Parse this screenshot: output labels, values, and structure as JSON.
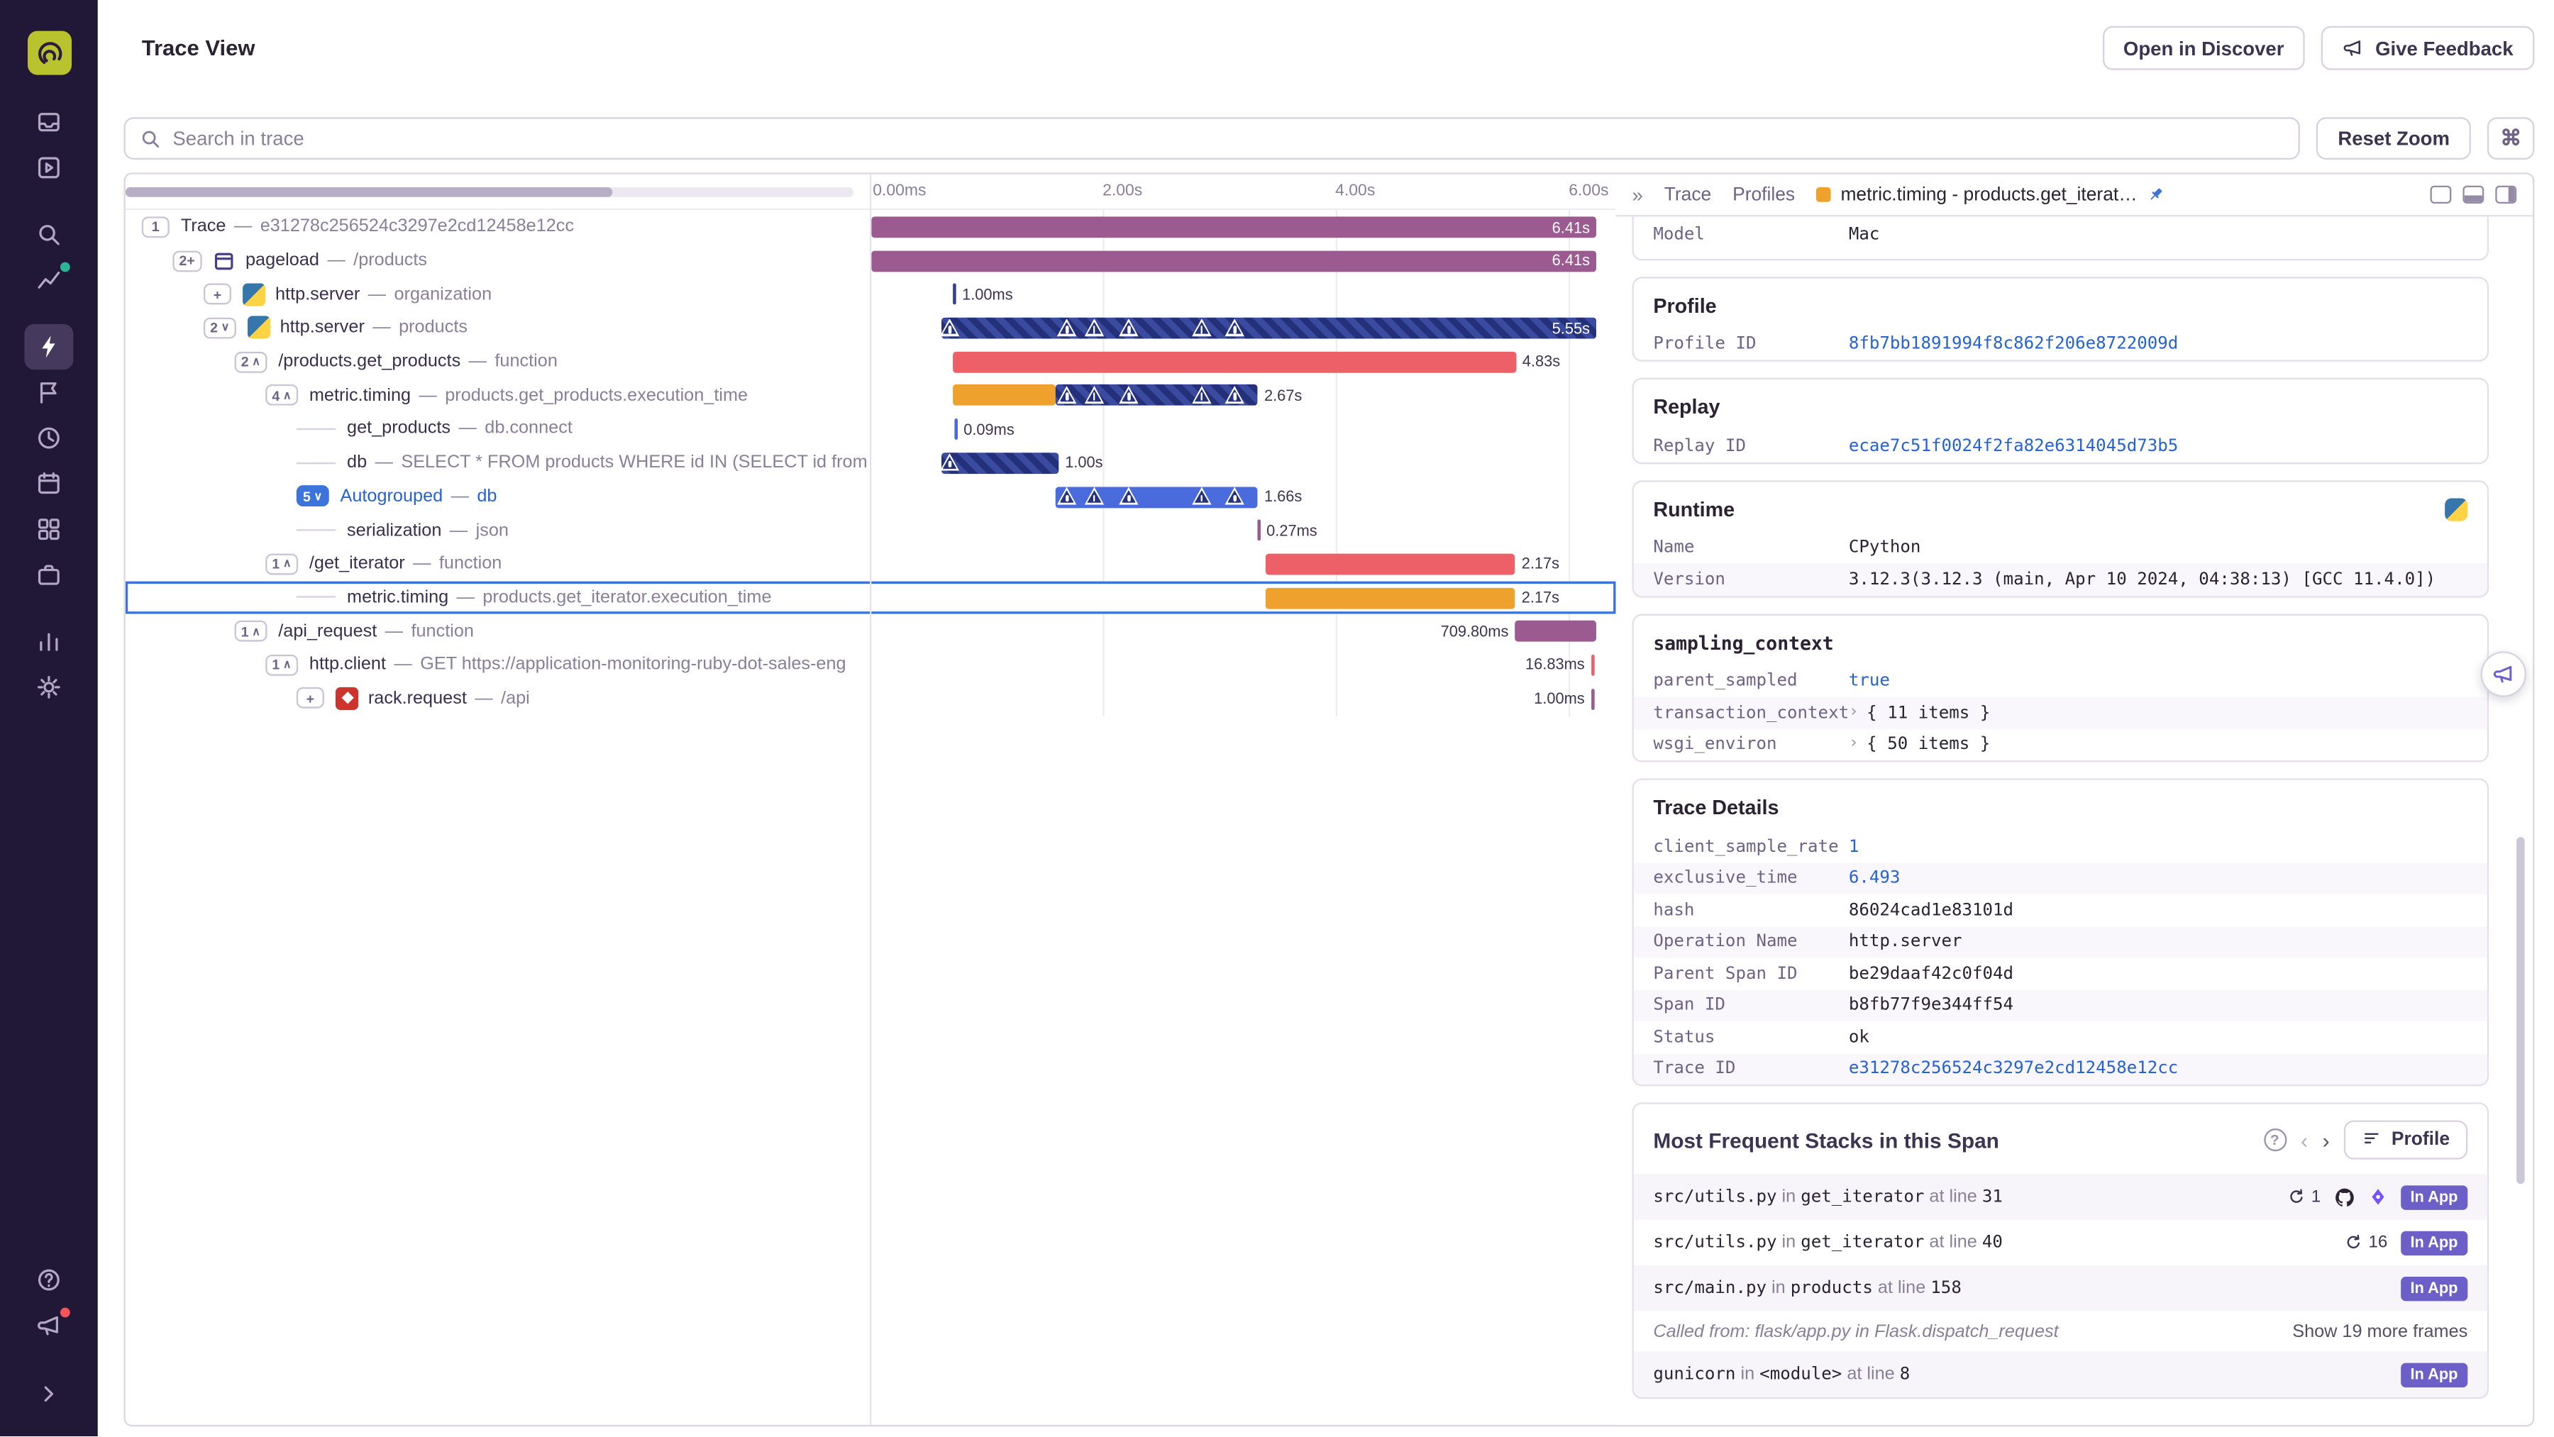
{
  "header": {
    "title": "Trace View",
    "open_in_discover": "Open in Discover",
    "give_feedback": "Give Feedback"
  },
  "toolbar": {
    "search_placeholder": "Search in trace",
    "reset_zoom": "Reset Zoom",
    "shortcut": "⌘"
  },
  "sidebar": {
    "items": [
      "issues",
      "projects",
      "explore-search",
      "stats",
      "performance",
      "releases",
      "history",
      "crons",
      "dashboards",
      "organization",
      "insights",
      "settings"
    ],
    "active": "performance",
    "bottom": [
      "help",
      "whats-new",
      "collapse"
    ]
  },
  "timeline": {
    "ticks": [
      {
        "label": "0.00ms",
        "pct": 0.4
      },
      {
        "label": "2.00s",
        "pct": 31.2
      },
      {
        "label": "4.00s",
        "pct": 62.4
      },
      {
        "label": "6.00s",
        "pct": 93.7
      }
    ]
  },
  "trace": {
    "separator": "—",
    "rows": [
      {
        "depth": 0,
        "badge": "1",
        "op": "Trace",
        "desc": "e31278c256524c3297e2cd12458e12cc",
        "segs": [
          {
            "l": 0.2,
            "w": 97.2,
            "c": "purple"
          }
        ],
        "label": "6.41s",
        "lp": "inside"
      },
      {
        "depth": 1,
        "badge": "2+",
        "icon": "pageload",
        "op": "pageload",
        "desc": "/products",
        "segs": [
          {
            "l": 0.2,
            "w": 97.2,
            "c": "purple"
          }
        ],
        "label": "6.41s",
        "lp": "inside"
      },
      {
        "depth": 2,
        "badge": "+",
        "icon": "python",
        "op": "http.server",
        "desc": "organization",
        "segs": [
          {
            "l": 11.1,
            "w": 0.4,
            "c": "navy"
          }
        ],
        "label": "1.00ms",
        "lp": "after"
      },
      {
        "depth": 2,
        "badge": "2",
        "chev": "down",
        "icon": "python",
        "op": "http.server",
        "desc": "products",
        "segs": [
          {
            "l": 9.6,
            "w": 87.8,
            "c": "striped"
          }
        ],
        "tris": [
          10.7,
          26.4,
          30.1,
          34.7,
          44.5,
          48.9
        ],
        "label": "5.55s",
        "lp": "inside"
      },
      {
        "depth": 3,
        "badge": "2",
        "chev": "up",
        "op": "/products.get_products",
        "desc": "function",
        "segs": [
          {
            "l": 11.1,
            "w": 75.5,
            "c": "red"
          }
        ],
        "label": "4.83s",
        "lp": "after"
      },
      {
        "depth": 4,
        "badge": "4",
        "chev": "up",
        "op": "metric.timing",
        "desc": "products.get_products.execution_time",
        "segs": [
          {
            "l": 11.1,
            "w": 13.8,
            "c": "orange"
          },
          {
            "l": 24.9,
            "w": 27.1,
            "c": "striped"
          }
        ],
        "tris": [
          26.4,
          30.1,
          34.7,
          44.5,
          48.9
        ],
        "label": "2.67s",
        "lp": "after"
      },
      {
        "depth": 5,
        "op": "get_products",
        "desc": "db.connect",
        "segs": [
          {
            "l": 11.4,
            "w": 0.3,
            "c": "blue"
          }
        ],
        "label": "0.09ms",
        "lp": "after"
      },
      {
        "depth": 5,
        "op": "db",
        "desc": "SELECT * FROM products WHERE id IN (SELECT id from produc",
        "segs": [
          {
            "l": 9.6,
            "w": 15.7,
            "c": "striped"
          }
        ],
        "tris": [
          10.7
        ],
        "label": "1.00s",
        "lp": "after"
      },
      {
        "depth": 5,
        "badge": "5",
        "chev": "down",
        "badge_style": "blue",
        "blue": true,
        "op": "Autogrouped",
        "desc": "db",
        "segs": [
          {
            "l": 24.9,
            "w": 27.1,
            "c": "blue"
          }
        ],
        "tris": [
          26.4,
          30.1,
          34.7,
          44.5,
          48.9
        ],
        "label": "1.66s",
        "lp": "after"
      },
      {
        "depth": 5,
        "op": "serialization",
        "desc": "json",
        "segs": [
          {
            "l": 52.0,
            "w": 0.3,
            "c": "purple"
          }
        ],
        "label": "0.27ms",
        "lp": "after"
      },
      {
        "depth": 4,
        "badge": "1",
        "chev": "up",
        "op": "/get_iterator",
        "desc": "function",
        "segs": [
          {
            "l": 53.1,
            "w": 33.4,
            "c": "red"
          }
        ],
        "label": "2.17s",
        "lp": "after"
      },
      {
        "depth": 5,
        "selected": true,
        "op": "metric.timing",
        "desc": "products.get_iterator.execution_time",
        "segs": [
          {
            "l": 53.1,
            "w": 33.4,
            "c": "orange"
          }
        ],
        "label": "2.17s",
        "lp": "after"
      },
      {
        "depth": 3,
        "badge": "1",
        "chev": "up",
        "op": "/api_request",
        "desc": "function",
        "segs": [
          {
            "l": 86.5,
            "w": 10.9,
            "c": "purple"
          }
        ],
        "label": "709.80ms",
        "lp": "before"
      },
      {
        "depth": 4,
        "badge": "1",
        "chev": "up",
        "op": "http.client",
        "desc": "GET https://application-monitoring-ruby-dot-sales-eng",
        "segs": [
          {
            "l": 96.7,
            "w": 0.45,
            "c": "red"
          }
        ],
        "label": "16.83ms",
        "lp": "before"
      },
      {
        "depth": 5,
        "badge": "+",
        "icon": "ruby",
        "op": "rack.request",
        "desc": "/api",
        "segs": [
          {
            "l": 96.7,
            "w": 0.45,
            "c": "purple"
          }
        ],
        "label": "1.00ms",
        "lp": "before"
      }
    ]
  },
  "tabs": {
    "collapse": "»",
    "trace": "Trace",
    "profiles": "Profiles",
    "active_label": "metric.timing - products.get_iterat…"
  },
  "details": {
    "cards": [
      {
        "cut": true,
        "rows": [
          {
            "k": "Model",
            "v": "Mac"
          }
        ]
      },
      {
        "title": "Profile",
        "rows": [
          {
            "k": "Profile ID",
            "v": "8fb7bb1891994f8c862f206e8722009d",
            "t": "link"
          }
        ]
      },
      {
        "title": "Replay",
        "rows": [
          {
            "k": "Replay ID",
            "v": "ecae7c51f0024f2fa82e6314045d73b5",
            "t": "link"
          }
        ]
      },
      {
        "title": "Runtime",
        "icon": "python",
        "rows": [
          {
            "k": "Name",
            "v": "CPython"
          },
          {
            "k": "Version",
            "v": "3.12.3(3.12.3 (main, Apr 10 2024, 04:38:13) [GCC 11.4.0])"
          }
        ]
      },
      {
        "title": "sampling_context",
        "mono": true,
        "rows": [
          {
            "k": "parent_sampled",
            "v": "true",
            "t": "num"
          },
          {
            "k": "transaction_context",
            "v": "{ 11 items }",
            "exp": true
          },
          {
            "k": "wsgi_environ",
            "v": "{ 50 items }",
            "exp": true
          }
        ]
      },
      {
        "title": "Trace Details",
        "rows": [
          {
            "k": "client_sample_rate",
            "v": "1",
            "t": "num"
          },
          {
            "k": "exclusive_time",
            "v": "6.493",
            "t": "num"
          },
          {
            "k": "hash",
            "v": "86024cad1e83101d"
          },
          {
            "k": "Operation Name",
            "v": "http.server"
          },
          {
            "k": "Parent Span ID",
            "v": "be29daaf42c0f04d"
          },
          {
            "k": "Span ID",
            "v": "b8fb77f9e344ff54"
          },
          {
            "k": "Status",
            "v": "ok"
          },
          {
            "k": "Trace ID",
            "v": "e31278c256524c3297e2cd12458e12cc",
            "t": "link"
          }
        ]
      }
    ]
  },
  "stacks": {
    "title": "Most Frequent Stacks in this Span",
    "profile_label": "Profile",
    "in_word": "in",
    "at_line_word": "at line",
    "frames": [
      {
        "file": "src/utils.py",
        "fn": "get_iterator",
        "line": "31",
        "count": "1",
        "extra_icons": true,
        "badge": "In App"
      },
      {
        "file": "src/utils.py",
        "fn": "get_iterator",
        "line": "40",
        "count": "16",
        "badge": "In App"
      },
      {
        "file": "src/main.py",
        "fn": "products",
        "line": "158",
        "badge": "In App"
      },
      {
        "called": "Called from: flask/app.py in Flask.dispatch_request",
        "more": "Show 19 more frames"
      },
      {
        "file": "gunicorn",
        "fn": "<module>",
        "line": "8",
        "badge": "In App"
      }
    ]
  }
}
